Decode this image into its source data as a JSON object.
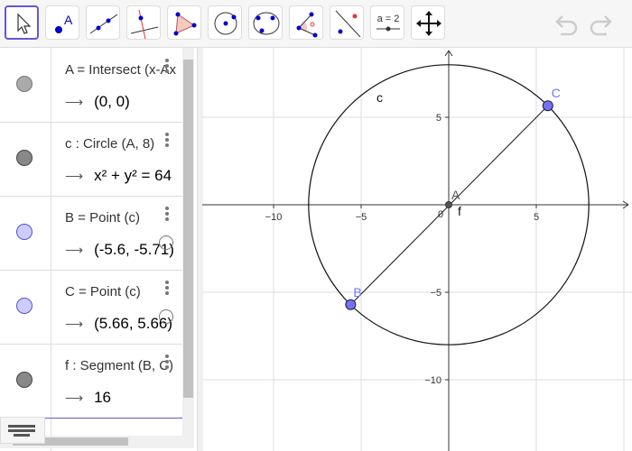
{
  "toolbar": {
    "tools": [
      {
        "name": "move-tool",
        "selected": true
      },
      {
        "name": "point-tool",
        "label": "A"
      },
      {
        "name": "line-tool"
      },
      {
        "name": "perpendicular-line-tool"
      },
      {
        "name": "polygon-tool"
      },
      {
        "name": "circle-center-point-tool"
      },
      {
        "name": "circle-three-points-tool"
      },
      {
        "name": "angle-tool"
      },
      {
        "name": "reflect-tool"
      },
      {
        "name": "slider-tool",
        "label": "a = 2"
      },
      {
        "name": "move-graphics-view-tool"
      }
    ],
    "undo": "undo-icon",
    "redo": "redo-icon"
  },
  "algebra": {
    "items": [
      {
        "definition": "A = Intersect (x-Ax",
        "value": "(0, 0)",
        "color": "#aaaaaa"
      },
      {
        "definition": "c : Circle (A, 8)",
        "value": "x² + y² = 64",
        "color": "#888888"
      },
      {
        "definition": "B = Point (c)",
        "value": "(-5.6, -5.71)",
        "color": "#ccccff"
      },
      {
        "definition": "C = Point (c)",
        "value": "(5.66, 5.66)",
        "color": "#ccccff"
      },
      {
        "definition": "f : Segment (B, C)",
        "value": "16",
        "color": "#888888"
      }
    ]
  },
  "graph": {
    "xticks": [
      "−10",
      "−5",
      "5"
    ],
    "xvals": [
      -10,
      -5,
      5
    ],
    "yticks": [
      "5",
      "−5",
      "−10"
    ],
    "yvals": [
      5,
      -5,
      -10
    ],
    "origin_label": "0",
    "circle": {
      "label": "c",
      "center": [
        0,
        0
      ],
      "radius": 8
    },
    "points": [
      {
        "label": "A",
        "x": 0,
        "y": 0
      },
      {
        "label": "B",
        "x": -5.6,
        "y": -5.71
      },
      {
        "label": "C",
        "x": 5.66,
        "y": 5.66
      }
    ],
    "segment_label": "f",
    "point_color": "#7272ff"
  }
}
